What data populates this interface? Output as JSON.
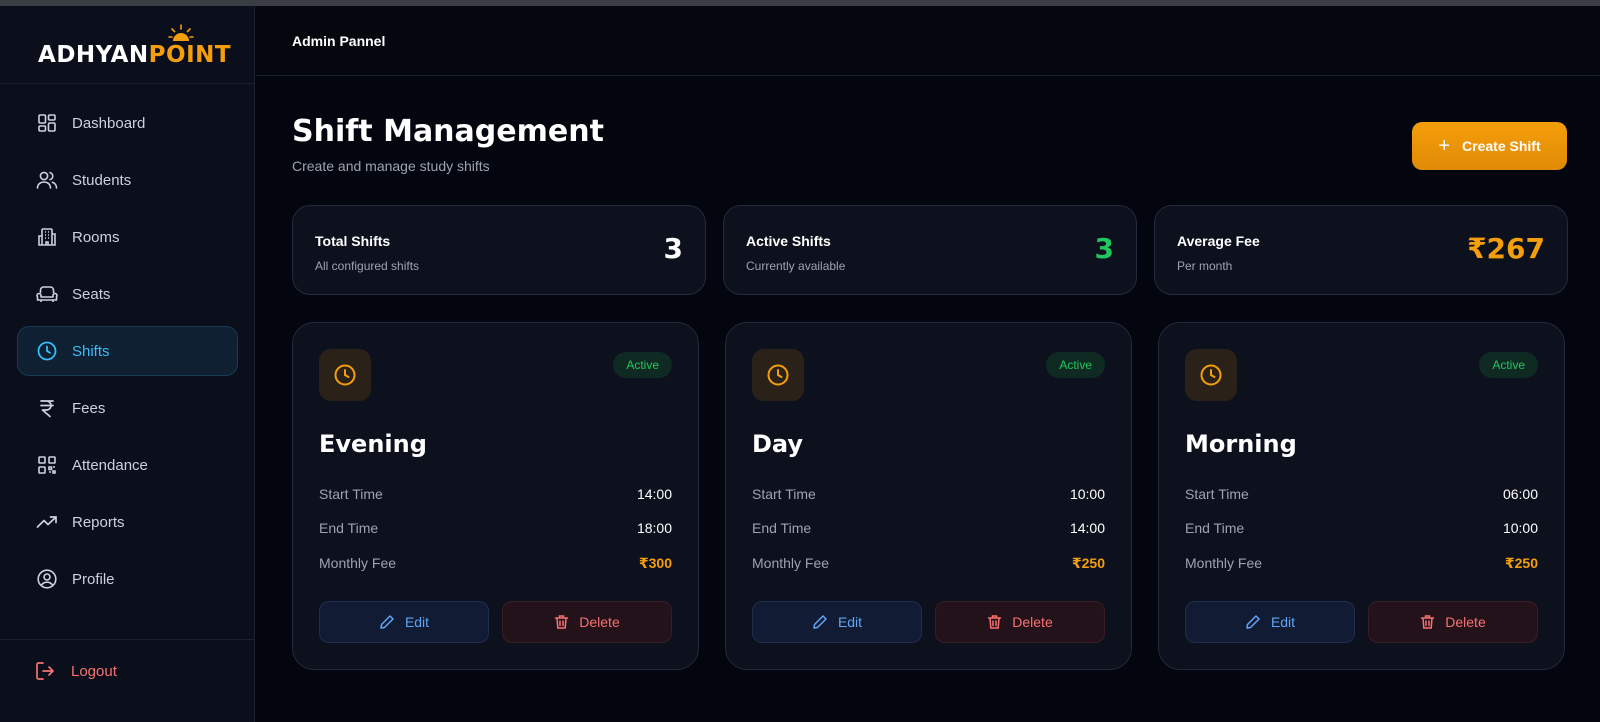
{
  "brand": {
    "name_white": "DHYAN",
    "name_orange": "POINT",
    "logo_mark": "A"
  },
  "sidebar": {
    "items": [
      {
        "label": "Dashboard",
        "icon": "dashboard-icon"
      },
      {
        "label": "Students",
        "icon": "users-icon"
      },
      {
        "label": "Rooms",
        "icon": "building-icon"
      },
      {
        "label": "Seats",
        "icon": "armchair-icon"
      },
      {
        "label": "Shifts",
        "icon": "clock-icon",
        "active": true
      },
      {
        "label": "Fees",
        "icon": "rupee-icon"
      },
      {
        "label": "Attendance",
        "icon": "qr-code-icon"
      },
      {
        "label": "Reports",
        "icon": "trending-up-icon"
      },
      {
        "label": "Profile",
        "icon": "user-circle-icon"
      }
    ],
    "logout_label": "Logout"
  },
  "header": {
    "title": "Admin Pannel"
  },
  "page": {
    "title": "Shift Management",
    "subtitle": "Create and manage study shifts",
    "create_label": "Create Shift"
  },
  "stats": [
    {
      "label": "Total Shifts",
      "sub": "All configured shifts",
      "value": "3",
      "color": "#ffffff"
    },
    {
      "label": "Active Shifts",
      "sub": "Currently available",
      "value": "3",
      "color": "#22c55e"
    },
    {
      "label": "Average Fee",
      "sub": "Per month",
      "value": "₹267",
      "color": "#f59e0b"
    }
  ],
  "shift_labels": {
    "start": "Start Time",
    "end": "End Time",
    "fee": "Monthly Fee",
    "edit": "Edit",
    "delete": "Delete"
  },
  "shifts": [
    {
      "name": "Evening",
      "status": "Active",
      "start": "14:00",
      "end": "18:00",
      "fee": "₹300"
    },
    {
      "name": "Day",
      "status": "Active",
      "start": "10:00",
      "end": "14:00",
      "fee": "₹250"
    },
    {
      "name": "Morning",
      "status": "Active",
      "start": "06:00",
      "end": "10:00",
      "fee": "₹250"
    }
  ],
  "colors": {
    "accent": "#f59e0b",
    "active_nav": "#38bdf8",
    "success": "#22c55e",
    "danger": "#f87171",
    "link": "#60a5fa"
  }
}
